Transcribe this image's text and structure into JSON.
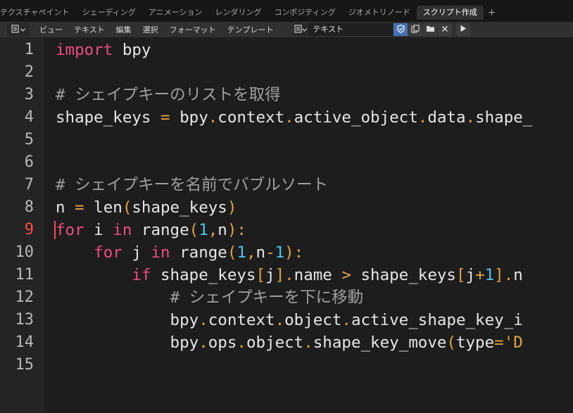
{
  "workspace_tabs": [
    {
      "label": "テクスチャペイント",
      "active": false
    },
    {
      "label": "シェーディング",
      "active": false
    },
    {
      "label": "アニメーション",
      "active": false
    },
    {
      "label": "レンダリング",
      "active": false
    },
    {
      "label": "コンポジティング",
      "active": false
    },
    {
      "label": "ジオメトリノード",
      "active": false
    },
    {
      "label": "スクリプト作成",
      "active": true
    }
  ],
  "add_tab_label": "+",
  "header": {
    "menus": [
      "ビュー",
      "テキスト",
      "編集",
      "選択",
      "フォーマット",
      "テンプレート"
    ],
    "text_block_name": "テキスト"
  },
  "editor": {
    "current_line": 9,
    "lines": [
      {
        "num": "1",
        "tokens": [
          {
            "t": "import",
            "k": "keyword"
          },
          {
            "t": " bpy",
            "k": "default"
          }
        ]
      },
      {
        "num": "2",
        "tokens": []
      },
      {
        "num": "3",
        "tokens": [
          {
            "t": "# シェイプキーのリストを取得",
            "k": "comment"
          }
        ]
      },
      {
        "num": "4",
        "tokens": [
          {
            "t": "shape_keys ",
            "k": "default"
          },
          {
            "t": "=",
            "k": "operator"
          },
          {
            "t": " bpy",
            "k": "default"
          },
          {
            "t": ".",
            "k": "operator"
          },
          {
            "t": "context",
            "k": "default"
          },
          {
            "t": ".",
            "k": "operator"
          },
          {
            "t": "active_object",
            "k": "default"
          },
          {
            "t": ".",
            "k": "operator"
          },
          {
            "t": "data",
            "k": "default"
          },
          {
            "t": ".",
            "k": "operator"
          },
          {
            "t": "shape_",
            "k": "default"
          }
        ]
      },
      {
        "num": "5",
        "tokens": []
      },
      {
        "num": "6",
        "tokens": []
      },
      {
        "num": "7",
        "tokens": [
          {
            "t": "# シェイプキーを名前でバブルソート",
            "k": "comment"
          }
        ]
      },
      {
        "num": "8",
        "tokens": [
          {
            "t": "n ",
            "k": "default"
          },
          {
            "t": "=",
            "k": "operator"
          },
          {
            "t": " len",
            "k": "default"
          },
          {
            "t": "(",
            "k": "operator"
          },
          {
            "t": "shape_keys",
            "k": "default"
          },
          {
            "t": ")",
            "k": "operator"
          }
        ]
      },
      {
        "num": "9",
        "tokens": [
          {
            "t": "for",
            "k": "keyword"
          },
          {
            "t": " i ",
            "k": "default"
          },
          {
            "t": "in",
            "k": "keyword"
          },
          {
            "t": " range",
            "k": "default"
          },
          {
            "t": "(",
            "k": "operator"
          },
          {
            "t": "1",
            "k": "number"
          },
          {
            "t": ",",
            "k": "operator"
          },
          {
            "t": "n",
            "k": "default"
          },
          {
            "t": "):",
            "k": "operator"
          }
        ]
      },
      {
        "num": "10",
        "tokens": [
          {
            "t": "    ",
            "k": "default"
          },
          {
            "t": "for",
            "k": "keyword"
          },
          {
            "t": " j ",
            "k": "default"
          },
          {
            "t": "in",
            "k": "keyword"
          },
          {
            "t": " range",
            "k": "default"
          },
          {
            "t": "(",
            "k": "operator"
          },
          {
            "t": "1",
            "k": "number"
          },
          {
            "t": ",",
            "k": "operator"
          },
          {
            "t": "n",
            "k": "default"
          },
          {
            "t": "-",
            "k": "operator"
          },
          {
            "t": "1",
            "k": "number"
          },
          {
            "t": "):",
            "k": "operator"
          }
        ]
      },
      {
        "num": "11",
        "tokens": [
          {
            "t": "        ",
            "k": "default"
          },
          {
            "t": "if",
            "k": "keyword"
          },
          {
            "t": " shape_keys",
            "k": "default"
          },
          {
            "t": "[",
            "k": "operator"
          },
          {
            "t": "j",
            "k": "default"
          },
          {
            "t": "].",
            "k": "operator"
          },
          {
            "t": "name ",
            "k": "default"
          },
          {
            "t": ">",
            "k": "operator"
          },
          {
            "t": " shape_keys",
            "k": "default"
          },
          {
            "t": "[",
            "k": "operator"
          },
          {
            "t": "j",
            "k": "default"
          },
          {
            "t": "+",
            "k": "operator"
          },
          {
            "t": "1",
            "k": "number"
          },
          {
            "t": "].",
            "k": "operator"
          },
          {
            "t": "n",
            "k": "default"
          }
        ]
      },
      {
        "num": "12",
        "tokens": [
          {
            "t": "            ",
            "k": "default"
          },
          {
            "t": "# シェイプキーを下に移動",
            "k": "comment"
          }
        ]
      },
      {
        "num": "13",
        "tokens": [
          {
            "t": "            bpy",
            "k": "default"
          },
          {
            "t": ".",
            "k": "operator"
          },
          {
            "t": "context",
            "k": "default"
          },
          {
            "t": ".",
            "k": "operator"
          },
          {
            "t": "object",
            "k": "default"
          },
          {
            "t": ".",
            "k": "operator"
          },
          {
            "t": "active_shape_key_i",
            "k": "default"
          }
        ]
      },
      {
        "num": "14",
        "tokens": [
          {
            "t": "            bpy",
            "k": "default"
          },
          {
            "t": ".",
            "k": "operator"
          },
          {
            "t": "ops",
            "k": "default"
          },
          {
            "t": ".",
            "k": "operator"
          },
          {
            "t": "object",
            "k": "default"
          },
          {
            "t": ".",
            "k": "operator"
          },
          {
            "t": "shape_key_move",
            "k": "default"
          },
          {
            "t": "(",
            "k": "operator"
          },
          {
            "t": "type",
            "k": "default"
          },
          {
            "t": "=",
            "k": "operator"
          },
          {
            "t": "'D",
            "k": "string"
          }
        ]
      },
      {
        "num": "15",
        "tokens": []
      }
    ]
  },
  "icons": {
    "editor_type": "text-editor-icon",
    "dropdown": "chevron-down-icon",
    "fake_user": "shield-icon",
    "duplicate": "duplicate-icon",
    "open": "folder-icon",
    "unlink": "close-icon",
    "run": "play-icon"
  },
  "colors": {
    "keyword": "#ee4c81",
    "operator": "#e2a343",
    "number": "#4cc4e8",
    "comment": "#a0a0a0",
    "current_line_number": "#ff4a4a"
  }
}
